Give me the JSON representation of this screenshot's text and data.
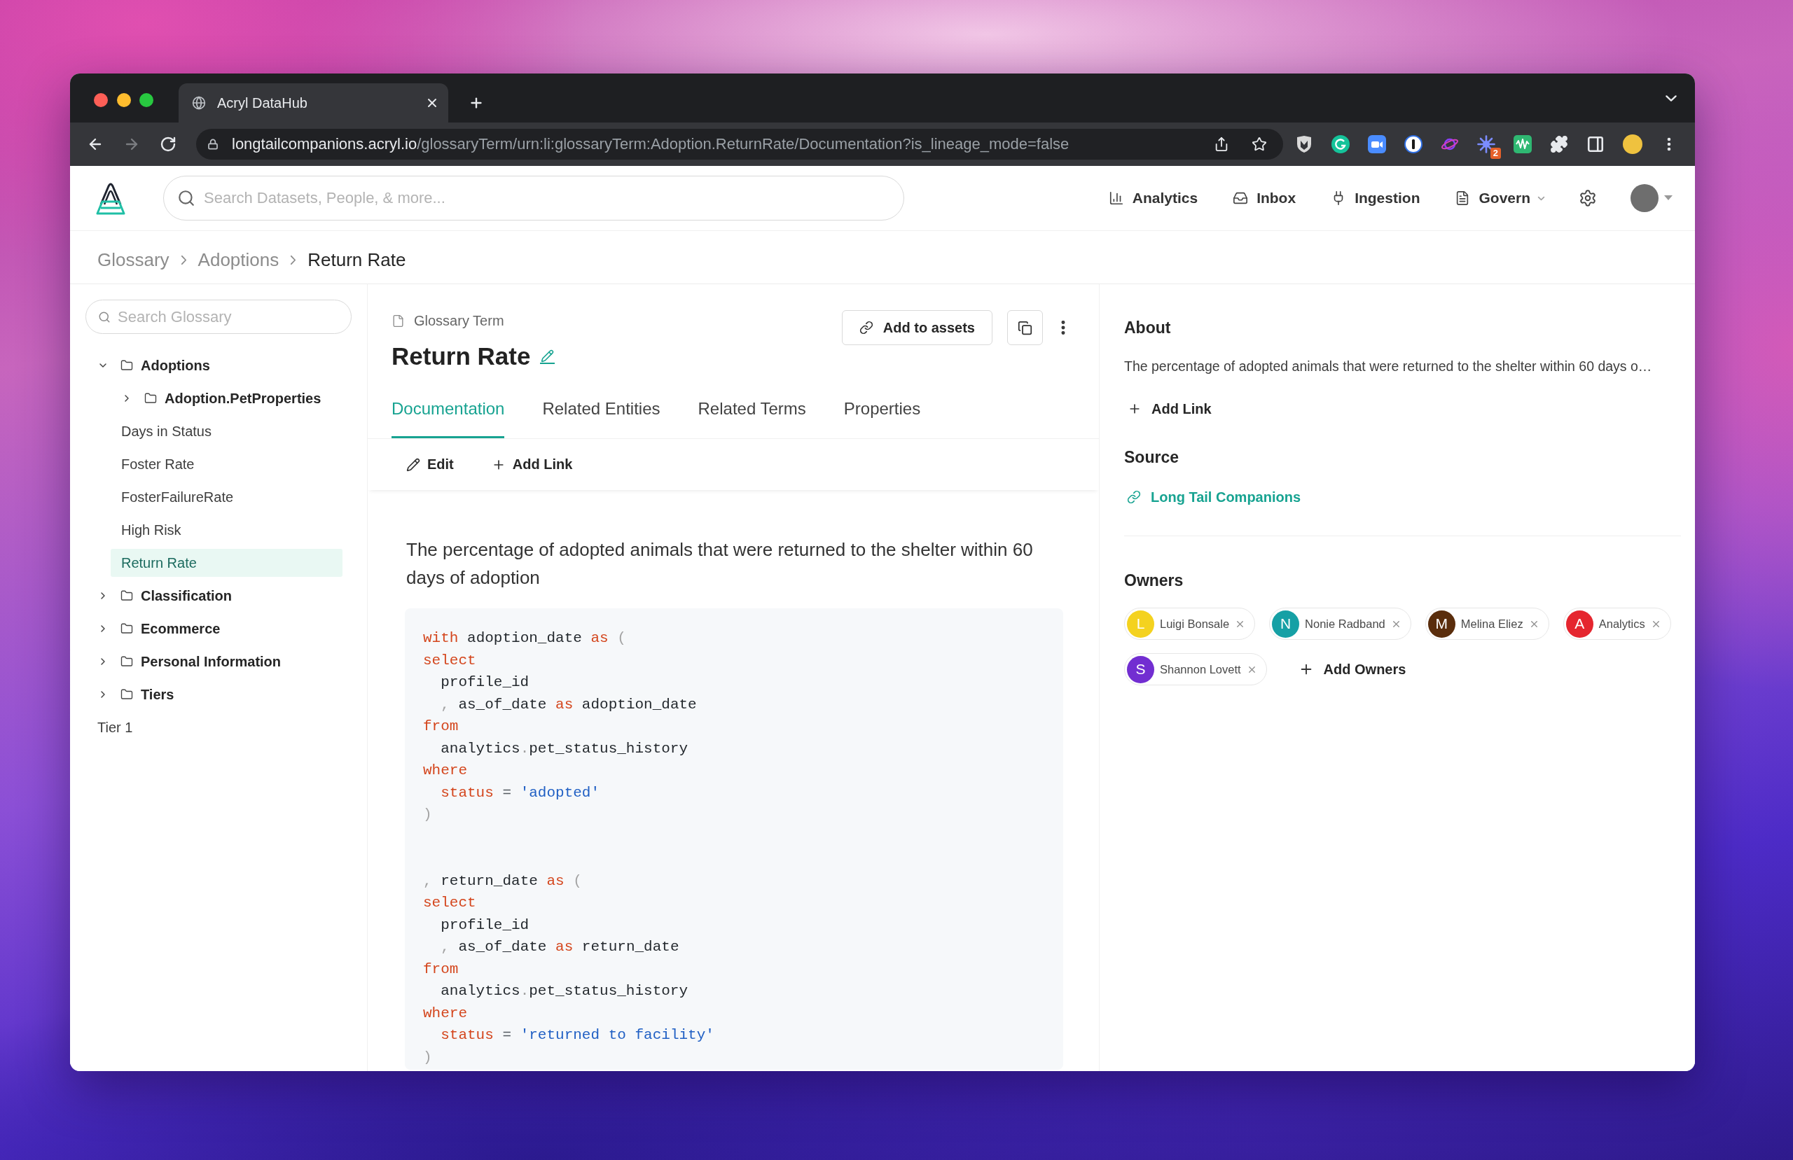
{
  "browser": {
    "tab_title": "Acryl DataHub",
    "url": {
      "host": "longtailcompanions.acryl.io",
      "path": "/glossaryTerm/urn:li:glossaryTerm:Adoption.ReturnRate/Documentation?is_lineage_mode=false"
    },
    "extension_badge": "2"
  },
  "header": {
    "search": {
      "placeholder": "Search Datasets, People, & more..."
    },
    "nav": [
      {
        "label": "Analytics",
        "dropdown": false
      },
      {
        "label": "Inbox",
        "dropdown": false
      },
      {
        "label": "Ingestion",
        "dropdown": false
      },
      {
        "label": "Govern",
        "dropdown": true
      }
    ]
  },
  "breadcrumb": [
    "Glossary",
    "Adoptions",
    "Return Rate"
  ],
  "sidebar": {
    "search": {
      "placeholder": "Search Glossary"
    },
    "tree": [
      {
        "kind": "folder",
        "label": "Adoptions",
        "expanded": true,
        "selected": false,
        "children": [
          {
            "kind": "folder",
            "label": "Adoption.PetProperties",
            "expanded": false,
            "selected": false
          },
          {
            "kind": "term",
            "label": "Days in Status",
            "selected": false
          },
          {
            "kind": "term",
            "label": "Foster Rate",
            "selected": false
          },
          {
            "kind": "term",
            "label": "FosterFailureRate",
            "selected": false
          },
          {
            "kind": "term",
            "label": "High Risk",
            "selected": false
          },
          {
            "kind": "term",
            "label": "Return Rate",
            "selected": true
          }
        ]
      },
      {
        "kind": "folder",
        "label": "Classification",
        "expanded": false,
        "selected": false
      },
      {
        "kind": "folder",
        "label": "Ecommerce",
        "expanded": false,
        "selected": false
      },
      {
        "kind": "folder",
        "label": "Personal Information",
        "expanded": false,
        "selected": false
      },
      {
        "kind": "folder",
        "label": "Tiers",
        "expanded": false,
        "selected": false
      },
      {
        "kind": "term",
        "label": "Tier 1",
        "selected": false
      }
    ]
  },
  "entity": {
    "type_label": "Glossary Term",
    "title": "Return Rate",
    "add_to_assets": "Add to assets",
    "tabs": [
      {
        "label": "Documentation",
        "selected": true
      },
      {
        "label": "Related Entities",
        "selected": false
      },
      {
        "label": "Related Terms",
        "selected": false
      },
      {
        "label": "Properties",
        "selected": false
      }
    ],
    "toolbar": [
      "Edit",
      "Add Link"
    ],
    "description": "The percentage of adopted animals that were returned to the shelter within 60 days of adoption",
    "code_block": {
      "sections": [
        {
          "lines": [
            [
              {
                "kind": "kw",
                "text": "with"
              },
              {
                "kind": "id",
                "text": " adoption_date "
              },
              {
                "kind": "kw",
                "text": "as"
              },
              {
                "kind": "punct",
                "text": " ("
              }
            ],
            [
              {
                "kind": "kw",
                "text": "select"
              }
            ],
            [
              {
                "kind": "id",
                "text": "  profile_id"
              }
            ],
            [
              {
                "kind": "punct",
                "text": "  ,"
              },
              {
                "kind": "id",
                "text": " as_of_date "
              },
              {
                "kind": "kw",
                "text": "as"
              },
              {
                "kind": "id",
                "text": " adoption_date"
              }
            ],
            [
              {
                "kind": "kw",
                "text": "from"
              }
            ],
            [
              {
                "kind": "id",
                "text": "  analytics"
              },
              {
                "kind": "punct",
                "text": "."
              },
              {
                "kind": "id",
                "text": "pet_status_history"
              }
            ],
            [
              {
                "kind": "kw",
                "text": "where"
              }
            ],
            [
              {
                "kind": "kw",
                "text": "  status"
              },
              {
                "kind": "op",
                "text": " = "
              },
              {
                "kind": "str",
                "text": "'adopted'"
              }
            ],
            [
              {
                "kind": "punct",
                "text": ")"
              }
            ]
          ]
        },
        {
          "lines": [
            [
              {
                "kind": "punct",
                "text": ","
              },
              {
                "kind": "id",
                "text": " return_date "
              },
              {
                "kind": "kw",
                "text": "as"
              },
              {
                "kind": "punct",
                "text": " ("
              }
            ],
            [
              {
                "kind": "kw",
                "text": "select"
              }
            ],
            [
              {
                "kind": "id",
                "text": "  profile_id"
              }
            ],
            [
              {
                "kind": "punct",
                "text": "  ,"
              },
              {
                "kind": "id",
                "text": " as_of_date "
              },
              {
                "kind": "kw",
                "text": "as"
              },
              {
                "kind": "id",
                "text": " return_date"
              }
            ],
            [
              {
                "kind": "kw",
                "text": "from"
              }
            ],
            [
              {
                "kind": "id",
                "text": "  analytics"
              },
              {
                "kind": "punct",
                "text": "."
              },
              {
                "kind": "id",
                "text": "pet_status_history"
              }
            ],
            [
              {
                "kind": "kw",
                "text": "where"
              }
            ],
            [
              {
                "kind": "kw",
                "text": "  status"
              },
              {
                "kind": "op",
                "text": " = "
              },
              {
                "kind": "str",
                "text": "'returned to facility'"
              }
            ],
            [
              {
                "kind": "punct",
                "text": ")"
              }
            ]
          ]
        }
      ]
    }
  },
  "about": {
    "heading": "About",
    "summary": "The percentage of adopted animals that were returned to the shelter within 60 days o…",
    "add_link": "Add Link"
  },
  "source": {
    "heading": "Source",
    "link": "Long Tail Companions"
  },
  "owners": {
    "heading": "Owners",
    "items": [
      {
        "initial": "L",
        "name": "Luigi Bonsale",
        "color": "#f4d21f"
      },
      {
        "initial": "N",
        "name": "Nonie Radband",
        "color": "#16a0a5"
      },
      {
        "initial": "M",
        "name": "Melina Eliez",
        "color": "#5a2d0c"
      },
      {
        "initial": "A",
        "name": "Analytics",
        "color": "#e5262f"
      },
      {
        "initial": "S",
        "name": "Shannon Lovett",
        "color": "#722ed1"
      }
    ],
    "add_label": "Add Owners"
  }
}
